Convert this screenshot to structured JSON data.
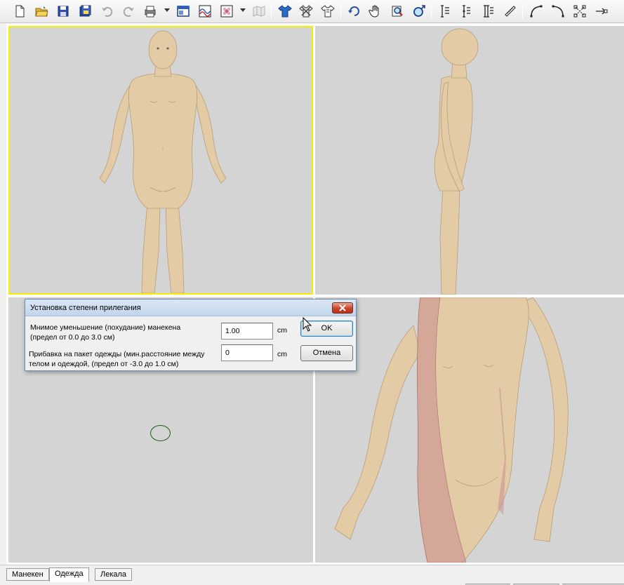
{
  "toolbar": {
    "buttons": [
      {
        "icon": "new-document-icon"
      },
      {
        "icon": "open-folder-icon"
      },
      {
        "icon": "save-icon"
      },
      {
        "icon": "save-all-icon"
      },
      {
        "icon": "undo-icon",
        "enabled": false
      },
      {
        "icon": "redo-icon",
        "enabled": false
      },
      {
        "icon": "print-icon"
      },
      {
        "icon": "single-view-icon"
      },
      {
        "icon": "texture-icon"
      },
      {
        "icon": "fabric-pattern-icon"
      },
      {
        "icon": "map-icon",
        "enabled": false
      },
      {
        "icon": "shirt-icon"
      },
      {
        "icon": "shirt-tools-icon"
      },
      {
        "icon": "shirt-outline-icon"
      },
      {
        "icon": "rotate-icon"
      },
      {
        "icon": "pan-hand-icon"
      },
      {
        "icon": "zoom-icon"
      },
      {
        "icon": "zoom-fit-icon"
      },
      {
        "icon": "vertical-measure-icon"
      },
      {
        "icon": "vertical-measure-2-icon"
      },
      {
        "icon": "vertical-measure-3-icon"
      },
      {
        "icon": "ruler-icon"
      },
      {
        "icon": "curve-left-icon"
      },
      {
        "icon": "curve-right-icon"
      },
      {
        "icon": "points-icon"
      },
      {
        "icon": "pin-point-icon"
      }
    ]
  },
  "dialog": {
    "title": "Установка степени прилегания",
    "row1_label_line1": "Мнимое уменьшение    (похудание) манекена",
    "row1_label_line2": "(предел от 0.0 до 3.0 см)",
    "row1_value": "1.00",
    "row1_unit": "cm",
    "row2_label_line1": "Прибавка на пакет одежды (мин.расстояние между",
    "row2_label_line2": "телом и одеждой, (предел от -3.0 до 1.0 см)",
    "row2_value": "0",
    "row2_unit": "cm",
    "ok_label": "OK",
    "cancel_label": "Отмена"
  },
  "tabs": [
    {
      "label": "Манекен",
      "active": false
    },
    {
      "label": "Одежда",
      "active": true
    },
    {
      "label": "Лекала",
      "active": false
    }
  ],
  "colors": {
    "viewport_bg": "#d4d4d4",
    "skin": "#e3cba5",
    "active_viewport_border": "#f5f000",
    "garment_overlay": "#c98a8f"
  }
}
